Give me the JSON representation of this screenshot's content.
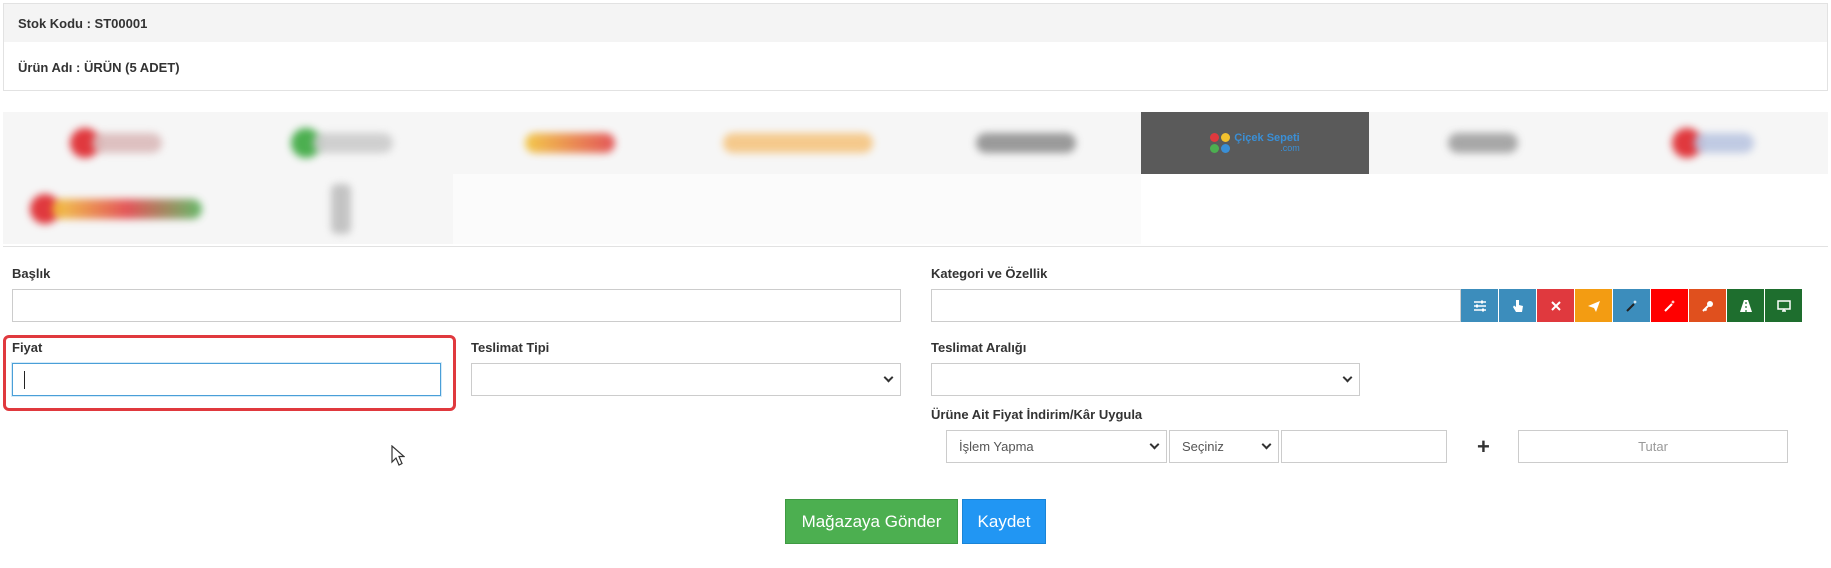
{
  "header": {
    "stock_code": "Stok Kodu : ST00001",
    "product_name": "Ürün Adı : ÜRÜN (5 ADET)"
  },
  "store_tabs": {
    "active_logo_name": "Çiçek Sepeti",
    "active_logo_suffix": ".com",
    "blurred_tab_colors": [
      "#e0393e",
      "#4caf50",
      "#f2c12e",
      "#f5a623",
      "#777777",
      "#8a8a8a",
      "#e0393e",
      "#e0393e",
      "#aaaaaa"
    ]
  },
  "form": {
    "title_label": "Başlık",
    "title_value": "",
    "category_label": "Kategori ve Özellik",
    "category_value": "",
    "price_label": "Fiyat",
    "price_value": "",
    "delivery_type_label": "Teslimat Tipi",
    "delivery_type_value": "",
    "delivery_range_label": "Teslimat Aralığı",
    "delivery_range_value": "",
    "discount_label": "Ürüne Ait Fiyat İndirim/Kâr Uygula",
    "discount_action_value": "İşlem Yapma",
    "discount_type_value": "Seçiniz",
    "discount_amount_value": "",
    "plus_symbol": "+",
    "amount_placeholder": "Tutar"
  },
  "icon_buttons": [
    {
      "icon": "sliders-icon",
      "color": "#3c8dbc"
    },
    {
      "icon": "hand-pointer-icon",
      "color": "#3c8dbc"
    },
    {
      "icon": "close-icon",
      "color": "#e0393e"
    },
    {
      "icon": "paper-plane-icon",
      "color": "#f39c12"
    },
    {
      "icon": "magic-wand-icon",
      "color": "#3c8dbc"
    },
    {
      "icon": "magic-wand-alt-icon",
      "color": "#ff0000"
    },
    {
      "icon": "key-icon",
      "color": "#e0501e"
    },
    {
      "icon": "road-icon",
      "color": "#1e6e2e"
    },
    {
      "icon": "desktop-icon",
      "color": "#1e6e2e"
    }
  ],
  "actions": {
    "send_to_store": "Mağazaya Gönder",
    "save": "Kaydet"
  }
}
